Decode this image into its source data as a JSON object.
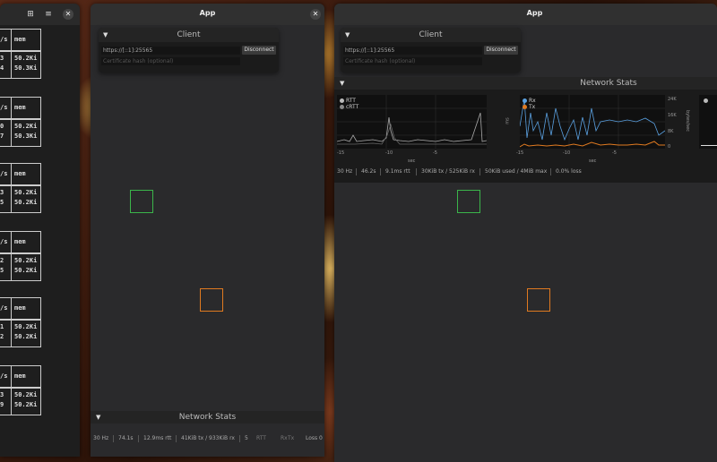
{
  "terminal": {
    "rows": [
      {
        "h": "/s",
        "m": "mem",
        "a": "3",
        "b": "4",
        "v1": "50.2Ki",
        "v2": "50.3Ki"
      },
      {
        "h": "/s",
        "m": "mem",
        "a": "0",
        "b": "7",
        "v1": "50.2Ki",
        "v2": "50.3Ki"
      },
      {
        "h": "/s",
        "m": "mem",
        "a": "3",
        "b": "5",
        "v1": "50.2Ki",
        "v2": "50.2Ki"
      },
      {
        "h": "/s",
        "m": "mem",
        "a": "2",
        "b": "5",
        "v1": "50.2Ki",
        "v2": "50.2Ki"
      },
      {
        "h": "/s",
        "m": "mem",
        "a": "1",
        "b": "2",
        "v1": "50.2Ki",
        "v2": "50.2Ki"
      },
      {
        "h": "/s",
        "m": "mem",
        "a": "3",
        "b": "9",
        "v1": "50.2Ki",
        "v2": "50.2Ki"
      }
    ]
  },
  "left_app": {
    "title": "App",
    "client": {
      "header": "Client",
      "address": "https://[::1]:25565",
      "cert_placeholder": "Certificate hash (optional)",
      "disconnect": "Disconnect"
    },
    "network_stats_label": "Network Stats",
    "status": [
      "30 Hz",
      "74.1s",
      "12.9ms rtt",
      "41KiB tx / 933KiB rx",
      "5",
      "RTT",
      "Rx",
      "Tx",
      "Loss",
      "0"
    ]
  },
  "right_app": {
    "title": "App",
    "client": {
      "header": "Client",
      "address": "https://[::1]:25565",
      "cert_placeholder": "Certificate hash (optional)",
      "disconnect": "Disconnect"
    },
    "network_stats_label": "Network Stats",
    "rtt_plot": {
      "legend": [
        "RTT",
        "cRTT"
      ],
      "xticks": [
        "-15",
        "-10",
        "-5"
      ],
      "xlabel": "sec",
      "ylabel": "ms"
    },
    "rx_plot": {
      "legend": [
        "Rx",
        "Tx"
      ],
      "xticks": [
        "-15",
        "-10",
        "-5"
      ],
      "xlabel": "sec",
      "yticks": [
        "24K",
        "16K",
        "8K",
        "0"
      ],
      "ylabel": "bytes/sec"
    },
    "status": [
      "30 Hz",
      "46.2s",
      "9.1ms rtt",
      "30KiB tx / 525KiB rx",
      "50KiB used / 4MiB max",
      "0.0% loss"
    ]
  },
  "colors": {
    "green": "#3bb54a",
    "orange": "#e07a20",
    "rx": "#5aa0e0",
    "tx": "#e07a20"
  }
}
